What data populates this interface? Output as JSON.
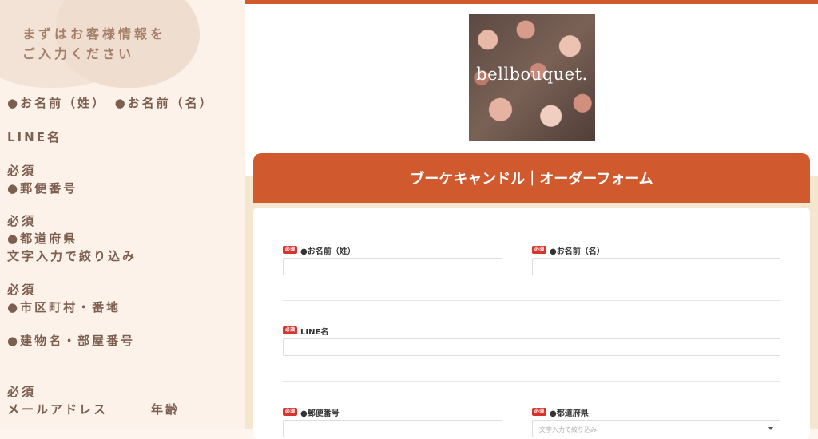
{
  "left_panel": {
    "intro_line1": "まずはお客様情報を",
    "intro_line2": "ご入力ください",
    "items": [
      "●お名前（姓）　●お名前（名）",
      "LINE名",
      "必須\n●郵便番号",
      "必須\n●都道府県\n文字入力で絞り込み",
      "必須\n●市区町村・番地",
      "●建物名・部屋番号",
      "必須\nメールアドレス　　　年齢"
    ]
  },
  "logo": {
    "text": "bellbouquet."
  },
  "form": {
    "title": "ブーケキャンドル｜オーダーフォーム",
    "required_badge": "必須",
    "fields": {
      "last_name": {
        "label": "●お名前（姓）",
        "value": ""
      },
      "first_name": {
        "label": "●お名前（名）",
        "value": ""
      },
      "line_name": {
        "label": "LINE名",
        "value": ""
      },
      "postal_code": {
        "label": "●郵便番号",
        "value": ""
      },
      "prefecture": {
        "label": "●都道府県",
        "placeholder": "文字入力で絞り込み"
      }
    }
  },
  "colors": {
    "accent": "#d0592e",
    "required": "#d7342d",
    "beige": "#f5e6cf",
    "left_bg": "#fcf2ea"
  }
}
